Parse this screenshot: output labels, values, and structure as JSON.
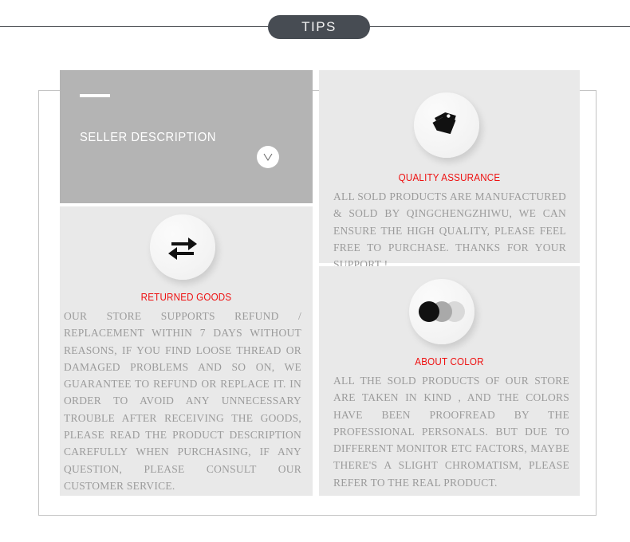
{
  "header": {
    "pill_label": "TIPS"
  },
  "seller": {
    "title": "SELLER DESCRIPTION",
    "chevron_icon": "chevron-down-icon"
  },
  "sections": {
    "quality": {
      "icon": "price-tag-icon",
      "title": "QUALITY ASSURANCE",
      "body": "ALL SOLD PRODUCTS ARE MANUFACTURED & SOLD BY QINGCHENGZHIWU, WE CAN ENSURE THE HIGH QUALITY, PLEASE FEEL FREE TO PURCHASE. THANKS FOR YOUR SUPPORT !"
    },
    "returned": {
      "icon": "repeat-arrows-icon",
      "title": "RETURNED GOODS",
      "body": "OUR STORE SUPPORTS REFUND / REPLACEMENT WITHIN 7 DAYS WITHOUT REASONS, IF YOU FIND LOOSE THREAD OR DAMAGED PROBLEMS AND SO ON, WE GUARANTEE TO REFUND OR REPLACE IT. IN ORDER TO AVOID ANY UNNECESSARY TROUBLE AFTER RECEIVING THE GOODS, PLEASE READ THE PRODUCT DESCRIPTION CAREFULLY WHEN PURCHASING, IF ANY QUESTION, PLEASE CONSULT OUR CUSTOMER SERVICE."
    },
    "color": {
      "icon": "color-swatches-icon",
      "title": "ABOUT COLOR",
      "body": "ALL THE SOLD PRODUCTS OF OUR STORE ARE TAKEN IN KIND , AND THE COLORS HAVE BEEN PROOFREAD BY THE PROFESSIONAL PERSONALS. BUT DUE TO DIFFERENT MONITOR ETC FACTORS, MAYBE THERE'S A SLIGHT CHROMATISM, PLEASE REFER TO THE REAL PRODUCT."
    }
  },
  "colors": {
    "pill_background": "#474c53",
    "accent_red": "#ee1111",
    "seller_panel": "#b4b4b4",
    "light_panel": "#e9e9e9",
    "body_text": "#9b9b9b",
    "frame_border": "#c4c4c4",
    "swatch_dark": "#111111",
    "swatch_mid": "#a9a9a9",
    "swatch_light": "#d9d9d9"
  }
}
